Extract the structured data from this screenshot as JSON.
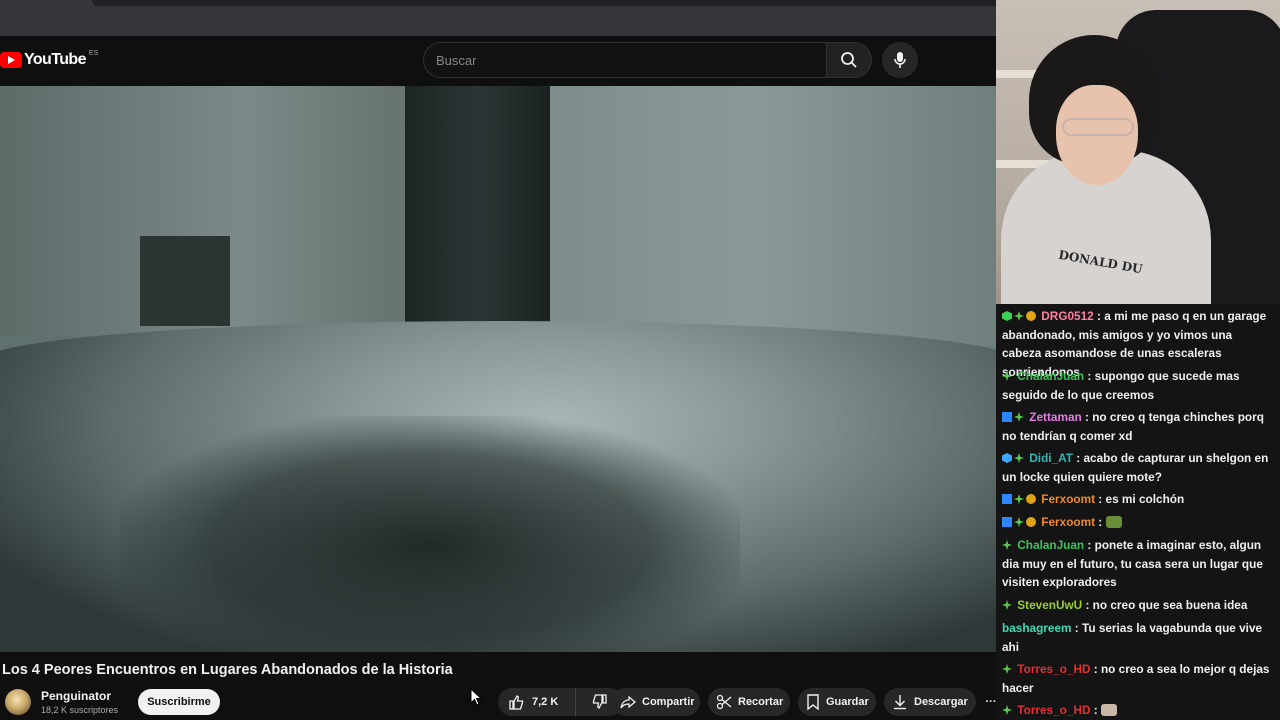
{
  "youtube": {
    "logo_text": "YouTube",
    "region": "ES",
    "search_placeholder": "Buscar",
    "video_title": "Los 4 Peores Encuentros en Lugares Abandonados de la Historia",
    "channel_name": "Penguinator",
    "subscribers": "18,2 K suscriptores",
    "subscribe_label": "Suscribirme",
    "like_count": "7,2 K",
    "share_label": "Compartir",
    "clip_label": "Recortar",
    "save_label": "Guardar",
    "download_label": "Descargar",
    "more_label": "···"
  },
  "webcam": {
    "hoodie_print": "DONALD DU"
  },
  "chat": {
    "messages": [
      {
        "badges": [
          "green",
          "diamond",
          "coin"
        ],
        "user": "DRG0512",
        "color": "#ff7f9f",
        "text": "a mi me paso q en un garage abandonado, mis amigos y yo vimos una cabeza asomandose de unas escaleras sonriendonos"
      },
      {
        "badges": [
          "diamond"
        ],
        "user": "ChalanJuan",
        "color": "#40c057",
        "text": "supongo que sucede mas seguido de lo que creemos"
      },
      {
        "badges": [
          "prime",
          "diamond"
        ],
        "user": "Zettaman",
        "color": "#e27ee0",
        "text": "no creo q tenga chinches porq no tendrían q comer xd"
      },
      {
        "badges": [
          "blue",
          "diamond"
        ],
        "user": "Didi_AT",
        "color": "#2eb8b8",
        "text": "acabo de capturar un shelgon en un locke quien quiere mote?"
      },
      {
        "badges": [
          "prime",
          "diamond",
          "coin"
        ],
        "user": "Ferxoomt",
        "color": "#f08a24",
        "text": "es mi colchón"
      },
      {
        "badges": [
          "prime",
          "diamond",
          "coin"
        ],
        "user": "Ferxoomt",
        "color": "#f08a24",
        "text": "",
        "emote": "pepe-emote"
      },
      {
        "badges": [
          "diamond"
        ],
        "user": "ChalanJuan",
        "color": "#40c057",
        "text": "ponete a imaginar esto, algun dia muy en el futuro, tu casa sera un lugar que visiten exploradores"
      },
      {
        "badges": [
          "diamond"
        ],
        "user": "StevenUwU",
        "color": "#9acd32",
        "text": "no creo que sea buena idea"
      },
      {
        "badges": [],
        "user": "bashagreem",
        "color": "#3ddbb3",
        "text": "Tu serias la vagabunda que vive ahi"
      },
      {
        "badges": [
          "diamond"
        ],
        "user": "Torres_o_HD",
        "color": "#e03131",
        "text": "no creo a sea lo mejor q dejas hacer"
      },
      {
        "badges": [
          "diamond"
        ],
        "user": "Torres_o_HD",
        "color": "#e03131",
        "text": "",
        "emote": "cat-emote"
      }
    ]
  }
}
